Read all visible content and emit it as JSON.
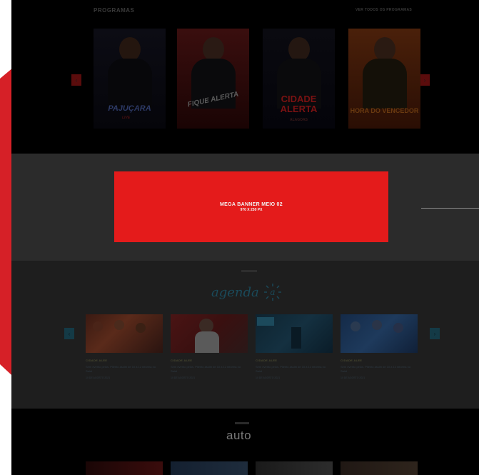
{
  "colors": {
    "accent_red": "#d62027",
    "dark": "#000000",
    "banner_red": "#e41b1b"
  },
  "programas": {
    "title": "PROGRAMAS",
    "link": "VER TODOS OS PROGRAMAS",
    "prev_icon": "‹",
    "next_icon": "›",
    "shows": [
      {
        "logo": "PAJUÇARA",
        "sub": "LIVE"
      },
      {
        "logo": "FIQUE ALERTA",
        "sub": ""
      },
      {
        "logo": "CIDADE ALERTA",
        "sub": "ALAGOAS"
      },
      {
        "logo": "HORA DO VENCEDOR",
        "sub": ""
      }
    ]
  },
  "banner": {
    "title": "MEGA BANNER MEIO 02",
    "size": "970 X 250 PX"
  },
  "agenda": {
    "logo_text": "agenda",
    "logo_mark": "a",
    "prev_icon": "‹",
    "next_icon": "›",
    "items": [
      {
        "category": "CIDADE ALEE",
        "text": "Sem evento pelos. Pliento assim de 10 a 12 informa no Saint",
        "date": "10 DE AGOSTO 2021"
      },
      {
        "category": "CIDADE ALEE",
        "text": "Sem evento pelos. Pliento assim de 10 a 12 informa no Saint",
        "date": "10 DE AGOSTO 2021"
      },
      {
        "category": "CIDADE ALEE",
        "text": "Sem evento pelos. Pliento assim de 10 a 12 informa no Saint",
        "date": "10 DE AGOSTO 2021"
      },
      {
        "category": "CIDADE ALEE",
        "text": "Sem evento pelos. Pliento assim de 10 a 12 informa no Saint",
        "date": "10 DE AGOSTO 2021"
      }
    ]
  },
  "auto": {
    "logo": "auto"
  }
}
